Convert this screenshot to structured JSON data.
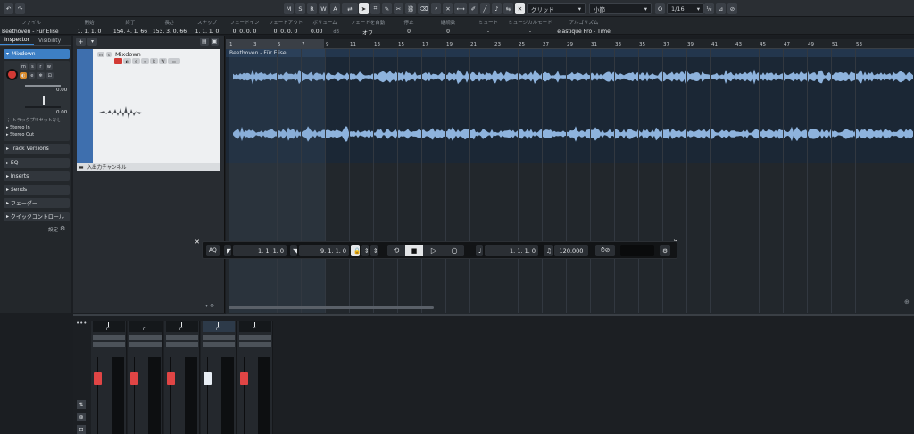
{
  "toolbar": {
    "mode_buttons": [
      "M",
      "S",
      "R",
      "W",
      "A"
    ],
    "grid_type": "グリッド",
    "grid_unit": "小節",
    "quantize": "1/16",
    "half": "½"
  },
  "info_line": {
    "headers": [
      "ファイル",
      "開始",
      "終了",
      "長さ",
      "スナップ",
      "フェードイン",
      "フェードアウト",
      "ボリューム",
      "フェードを自動",
      "停止",
      "継続数",
      "ミュート",
      "ミュージカルモード",
      "アルゴリズム"
    ],
    "values": [
      "Beethoven - Für Elise",
      "1. 1. 1.  0",
      "154. 4. 1. 66",
      "153. 3. 0. 66",
      "1. 1. 1.  0",
      "0. 0. 0.  0",
      "0. 0. 0.  0",
      "0.00",
      "オフ",
      "0",
      "0",
      "-",
      "-",
      "élastique Pro - Time"
    ],
    "volume_unit": "dB"
  },
  "inspector": {
    "tab_inspector": "Inspector",
    "tab_visibility": "Visibility",
    "track_name": "Mixdown",
    "gain_value": "0.00",
    "pan_value": "0.00",
    "preset_placeholder": "トラックプリセットなし",
    "input_routing": "Stereo In",
    "output_routing": "Stereo Out",
    "sections": [
      "Track Versions",
      "EQ",
      "Inserts",
      "Sends",
      "フェーダー",
      "クイックコントロール"
    ],
    "settings_label": "設定"
  },
  "tracklist": {
    "track_name": "Mixdown",
    "folder_label": "入出力チャンネル"
  },
  "ruler": {
    "ticks": [
      "1",
      "3",
      "5",
      "7",
      "9",
      "11",
      "13",
      "15",
      "17",
      "19",
      "21",
      "23",
      "25",
      "27",
      "29",
      "31",
      "33",
      "35",
      "37",
      "39",
      "41",
      "43",
      "45",
      "47",
      "49",
      "51",
      "53"
    ]
  },
  "clip": {
    "name": "Beethoven - Für Elise"
  },
  "transport": {
    "left_locator": "1. 1. 1.  0",
    "right_locator": "9. 1. 1.  0",
    "position": "1. 1. 1.  0",
    "tempo": "120.000"
  },
  "mixer": {
    "pan_label": "C",
    "strip_count": 5
  },
  "colors": {
    "accent": "#3e8bd8",
    "waveform": "#8eb3dd",
    "record": "#d23a35",
    "fader_red": "#e04545",
    "fader_white": "#e8eef4"
  }
}
